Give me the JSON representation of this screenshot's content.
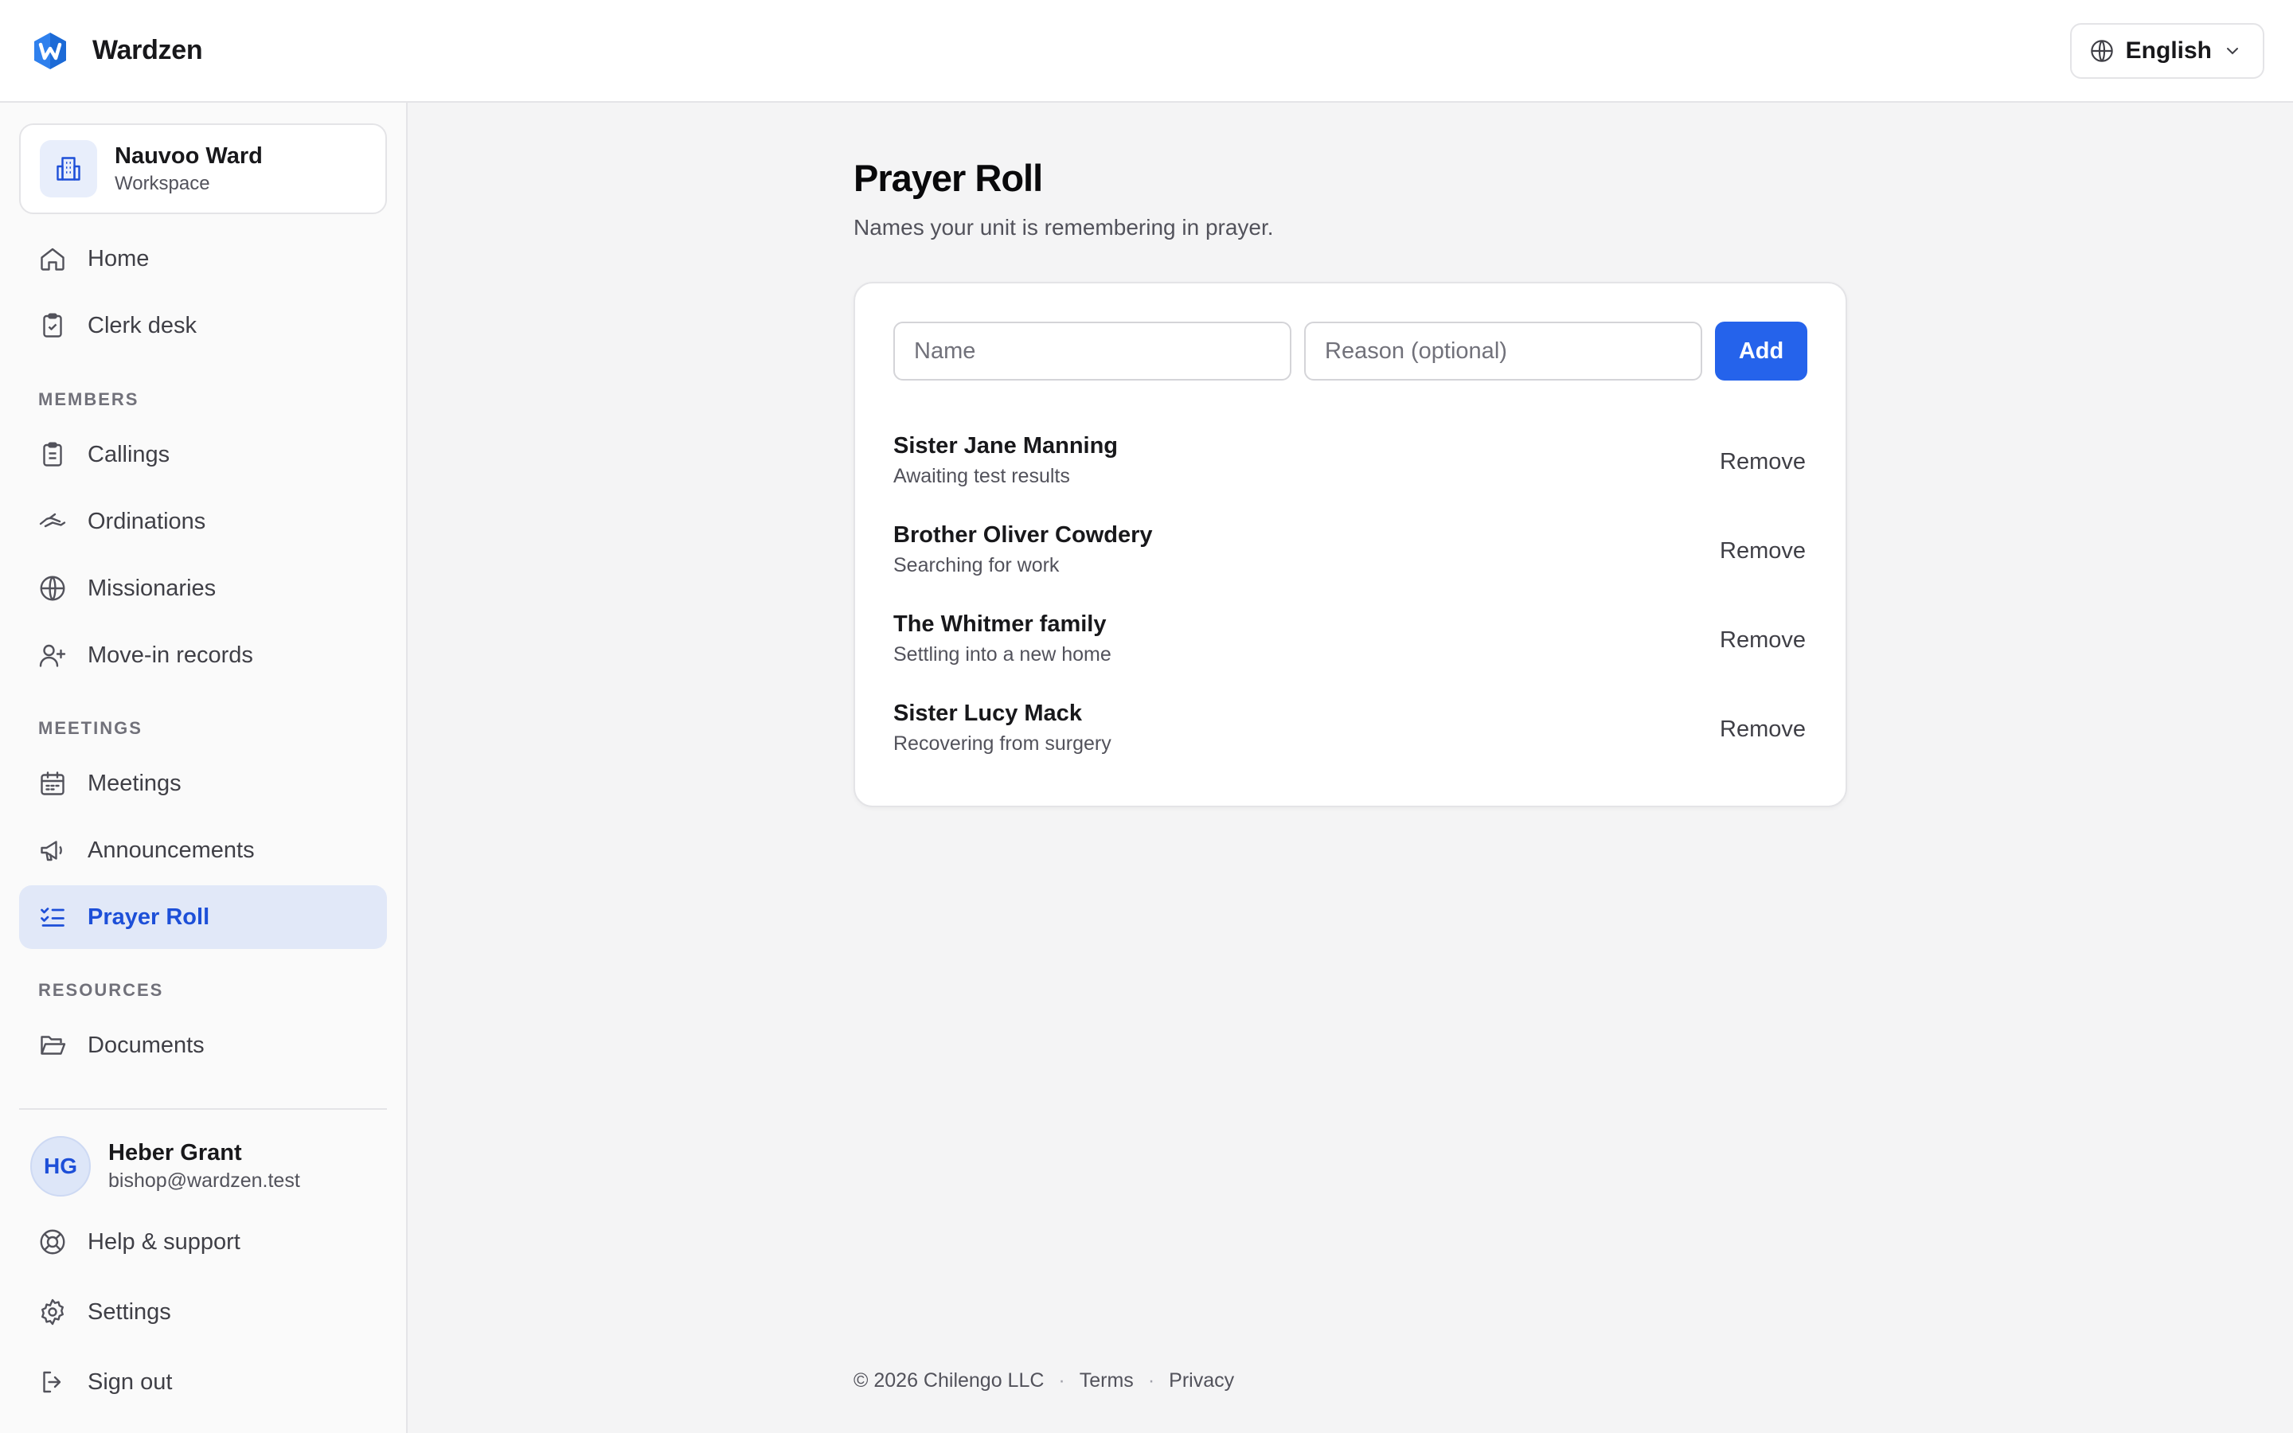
{
  "app": {
    "name": "Wardzen"
  },
  "language": {
    "selected": "English"
  },
  "workspace": {
    "name": "Nauvoo Ward",
    "label": "Workspace"
  },
  "sidebar": {
    "top_items": [
      {
        "label": "Home",
        "icon": "home-icon"
      },
      {
        "label": "Clerk desk",
        "icon": "clipboard-check-icon"
      }
    ],
    "sections": [
      {
        "label": "MEMBERS",
        "items": [
          {
            "label": "Callings",
            "icon": "clipboard-list-icon"
          },
          {
            "label": "Ordinations",
            "icon": "hand-icon"
          },
          {
            "label": "Missionaries",
            "icon": "globe-icon"
          },
          {
            "label": "Move-in records",
            "icon": "user-plus-icon"
          }
        ]
      },
      {
        "label": "MEETINGS",
        "items": [
          {
            "label": "Meetings",
            "icon": "calendar-icon"
          },
          {
            "label": "Announcements",
            "icon": "megaphone-icon"
          },
          {
            "label": "Prayer Roll",
            "icon": "list-checks-icon",
            "active": true
          }
        ]
      },
      {
        "label": "RESOURCES",
        "items": [
          {
            "label": "Documents",
            "icon": "folder-open-icon"
          }
        ]
      }
    ],
    "user": {
      "initials": "HG",
      "name": "Heber Grant",
      "email": "bishop@wardzen.test"
    },
    "bottom_items": [
      {
        "label": "Help & support",
        "icon": "life-buoy-icon"
      },
      {
        "label": "Settings",
        "icon": "gear-icon"
      },
      {
        "label": "Sign out",
        "icon": "sign-out-icon"
      }
    ]
  },
  "main": {
    "title": "Prayer Roll",
    "subtitle": "Names your unit is remembering in prayer.",
    "form": {
      "name_placeholder": "Name",
      "reason_placeholder": "Reason (optional)",
      "name_value": "",
      "reason_value": "",
      "add_label": "Add"
    },
    "remove_label": "Remove",
    "entries": [
      {
        "name": "Sister Jane Manning",
        "reason": "Awaiting test results"
      },
      {
        "name": "Brother Oliver Cowdery",
        "reason": "Searching for work"
      },
      {
        "name": "The Whitmer family",
        "reason": "Settling into a new home"
      },
      {
        "name": "Sister Lucy Mack",
        "reason": "Recovering from surgery"
      }
    ]
  },
  "footer": {
    "copyright": "© 2026 Chilengo LLC",
    "separator": "·",
    "terms": "Terms",
    "privacy": "Privacy"
  },
  "colors": {
    "accent": "#2563eb",
    "active_bg": "#e1e8f8",
    "active_text": "#1d4fd8",
    "logo": "#2f80ed"
  }
}
